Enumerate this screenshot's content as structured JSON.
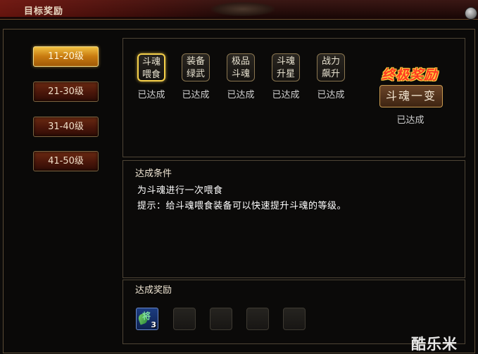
{
  "window": {
    "title": "目标奖励"
  },
  "levels": [
    {
      "label": "11-20级",
      "active": true
    },
    {
      "label": "21-30级",
      "active": false
    },
    {
      "label": "31-40级",
      "active": false
    },
    {
      "label": "41-50级",
      "active": false
    }
  ],
  "goals": [
    {
      "line1": "斗魂",
      "line2": "喂食",
      "status": "已达成",
      "active": true
    },
    {
      "line1": "装备",
      "line2": "绿武",
      "status": "已达成",
      "active": false
    },
    {
      "line1": "极品",
      "line2": "斗魂",
      "status": "已达成",
      "active": false
    },
    {
      "line1": "斗魂",
      "line2": "升星",
      "status": "已达成",
      "active": false
    },
    {
      "line1": "战力",
      "line2": "飙升",
      "status": "已达成",
      "active": false
    }
  ],
  "final_reward": {
    "title": "终极奖励",
    "button": "斗魂一变",
    "status": "已达成"
  },
  "condition": {
    "title": "达成条件",
    "line1": "为斗魂进行一次喂食",
    "line2": "提示：给斗魂喂食装备可以快速提升斗魂的等级。"
  },
  "reward": {
    "title": "达成奖励",
    "item_glyph": "将",
    "item_count": "3",
    "empty_slots": 4
  },
  "watermark": "酷乐米",
  "colors": {
    "accent_gold": "#f5d04a",
    "title_red": "#ff3a20",
    "button_red": "#4a160a"
  }
}
